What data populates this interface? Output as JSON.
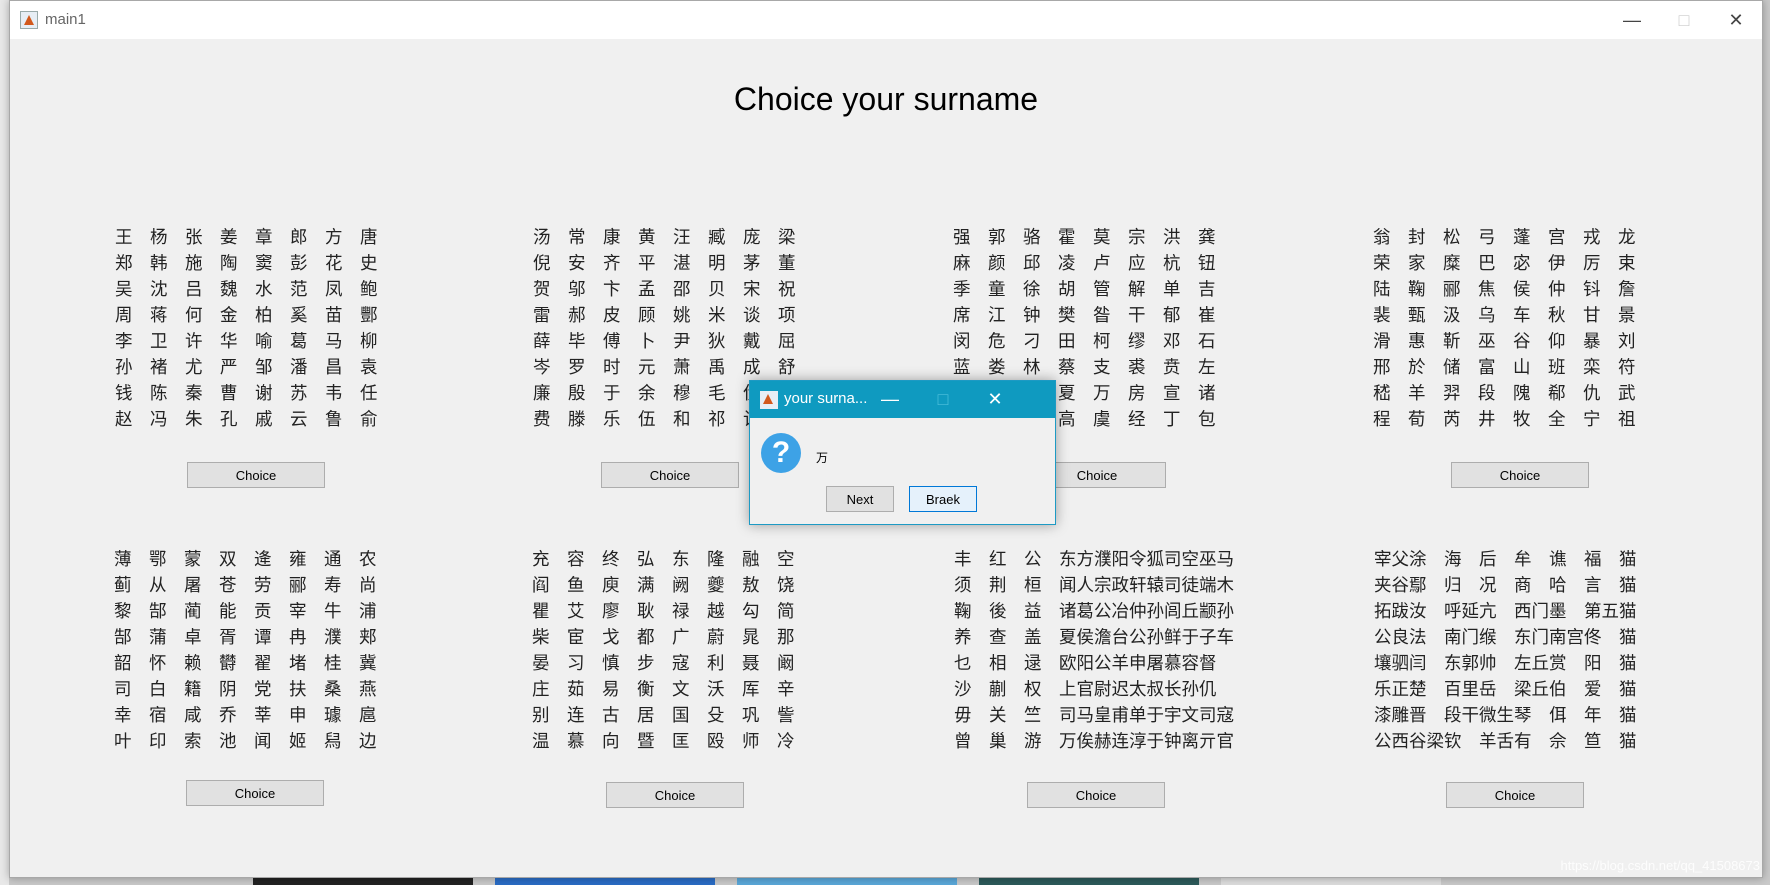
{
  "window": {
    "title": "main1",
    "heading": "Choice your surname"
  },
  "choice_label": "Choice",
  "blocks": [
    [
      "王杨张姜章郎方唐",
      "郑韩施陶窦彭花史",
      "吴沈吕魏水范凤鲍",
      "周蒋何金柏奚苗酆",
      "李卫许华喻葛马柳",
      "孙褚尤严邹潘昌袁",
      "钱陈秦曹谢苏韦任",
      "赵冯朱孔戚云鲁俞"
    ],
    [
      "汤常康黄汪臧庞梁",
      "倪安齐平湛明茅董",
      "贺邬卞孟邵贝宋祝",
      "雷郝皮顾姚米谈项",
      "薛毕傅卜尹狄戴屈",
      "岑罗时元萧禹成舒",
      "廉殷于余穆毛伏纪",
      "费滕乐伍和祁计熊"
    ],
    [
      "强郭骆霍莫宗洪龚",
      "麻颜邱凌卢应杭钮",
      "季童徐胡管解单吉",
      "席江钟樊昝干郁崔",
      "闵危刁田柯缪邓石",
      "蓝娄林蔡支裘贲左",
      "阮路盛夏万房宣诸",
      "杜贾梅高虞经丁包"
    ],
    [
      "翁封松弓蓬宫戎龙",
      "荣家糜巴宓伊厉束",
      "陆鞠郦焦侯仲钭詹",
      "裴甄汲乌车秋甘景",
      "滑惠靳巫谷仰暴刘",
      "邢於储富山班栾符",
      "嵇羊羿段隗郗仇武",
      "程荀芮井牧全宁祖"
    ],
    [
      "薄鄂蒙双逄雍通农",
      "蓟从屠苍劳郦寿尚",
      "黎郜蔺能贡宰牛浦",
      "郜蒲卓胥谭冉濮郏",
      "韶怀赖欎翟堵桂冀",
      "司白籍阴党扶桑燕",
      "幸宿咸乔莘申璩扈",
      "叶印索池闻姬舄边"
    ],
    [
      "充容终弘东隆融空",
      "阎鱼庾满阙夔敖饶",
      "瞿艾廖耿禄越勾简",
      "柴宦戈都广蔚晁那",
      "晏习慎步寇利聂阚",
      "庄茹易衡文沃厍辛",
      "别连古居国殳巩訾",
      "温慕向暨匡殴师冷"
    ]
  ],
  "block7": [
    {
      "single": "丰红公",
      "compound": "东方濮阳令狐司空巫马"
    },
    {
      "single": "须荆桓",
      "compound": "闻人宗政轩辕司徒端木"
    },
    {
      "single": "鞠後益",
      "compound": "诸葛公冶仲孙闾丘颛孙"
    },
    {
      "single": "养查盖",
      "compound": "夏侯澹台公孙鲜于子车"
    },
    {
      "single": "乜相逯",
      "compound": "欧阳公羊申屠慕容督"
    },
    {
      "single": "沙蒯权",
      "compound": "上官尉迟太叔长孙仉"
    },
    {
      "single": "毋关竺",
      "compound": "司马皇甫单于宇文司寇"
    },
    {
      "single": "曾巢游",
      "compound": "万俟赫连淳于钟离亓官"
    }
  ],
  "block8": [
    "宰父涂　海　后　牟　谯　福　猫",
    "夹谷鄢　归　况　商　哈　言　猫",
    "拓跋汝　呼延亢　西门墨　第五猫",
    "公良法　南门缑　东门南宫佟　猫",
    "壤驷闫　东郭帅　左丘赏　阳　猫",
    "乐正楚　百里岳　梁丘伯　爱　猫",
    "漆雕晋　段干微生琴　佴　年　猫",
    "公西谷梁钦　羊舌有　佘　笪　猫"
  ],
  "dialog": {
    "title": "your surna...",
    "message": "万",
    "next_label": "Next",
    "break_label": "Braek",
    "icon": "question-icon",
    "title_color": "#0f9ac0"
  },
  "watermark": "https://blog.csdn.net/qq_41508673"
}
